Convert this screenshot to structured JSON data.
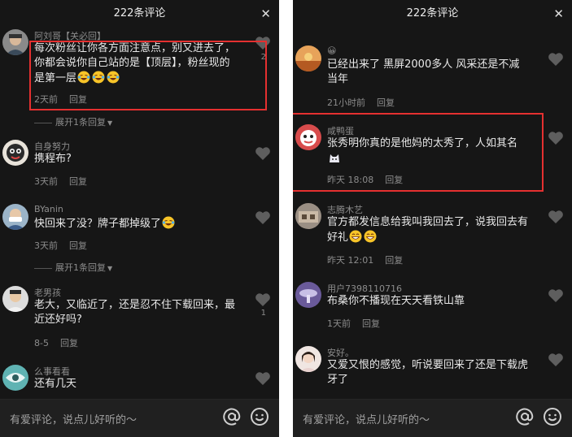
{
  "left": {
    "title": "222条评论",
    "close_icon": "close-icon",
    "comments": [
      {
        "user": "阿刘哥【关必回】",
        "text": "每次粉丝让你各方面注意点，别又进去了，你都会说你自己站的是【顶层】，粉丝现的是第一层",
        "emoji": [
          "laughing-crying-emoji",
          "laughing-crying-emoji",
          "laughing-crying-emoji"
        ],
        "time": "2天前",
        "reply": "回复",
        "likes": "2",
        "expand": "展开1条回复"
      },
      {
        "user": "自身努力",
        "text": "携程布?",
        "time": "3天前",
        "reply": "回复"
      },
      {
        "user": "BYanin",
        "text": "快回来了没？牌子都掉级了",
        "emoji": [
          "laughing-crying-emoji"
        ],
        "time": "3天前",
        "reply": "回复",
        "expand": "展开1条回复"
      },
      {
        "user": "老男孩",
        "text": "老大，又临近了，还是忍不住下载回来，最近还好吗?",
        "time": "8-5",
        "reply": "回复",
        "likes": "1"
      },
      {
        "user": "么事看看",
        "text": "还有几天"
      }
    ],
    "input_placeholder": "有爱评论，说点儿好听的～"
  },
  "right": {
    "title": "222条评论",
    "close_icon": "close-icon",
    "comments": [
      {
        "user": "😀",
        "text": "已经出来了 黑屏2000多人 风采还是不减当年",
        "time": "21小时前",
        "reply": "回复"
      },
      {
        "user": "咸鸭蛋",
        "text": "张秀明你真的是他妈的太秀了，人如其名",
        "emoji": [
          "cat-emoji"
        ],
        "time": "昨天 18:08",
        "reply": "回复"
      },
      {
        "user": "志腾木艺",
        "text": "官方都发信息给我叫我回去了，说我回去有好礼",
        "emoji": [
          "grinning-emoji",
          "grinning-emoji"
        ],
        "time": "昨天 12:01",
        "reply": "回复"
      },
      {
        "user": "用户7398110716",
        "text": "布桑你不播现在天天看铁山靠",
        "time": "1天前",
        "reply": "回复"
      },
      {
        "user": "安好。",
        "text": "又爱又恨的感觉，听说要回来了还是下载虎牙了"
      }
    ],
    "input_placeholder": "有爱评论，说点儿好听的～"
  },
  "colors": {
    "background": "#161616",
    "text": "#e9e9e9",
    "muted": "#8c8c8c",
    "highlight_box": "#e53030"
  }
}
